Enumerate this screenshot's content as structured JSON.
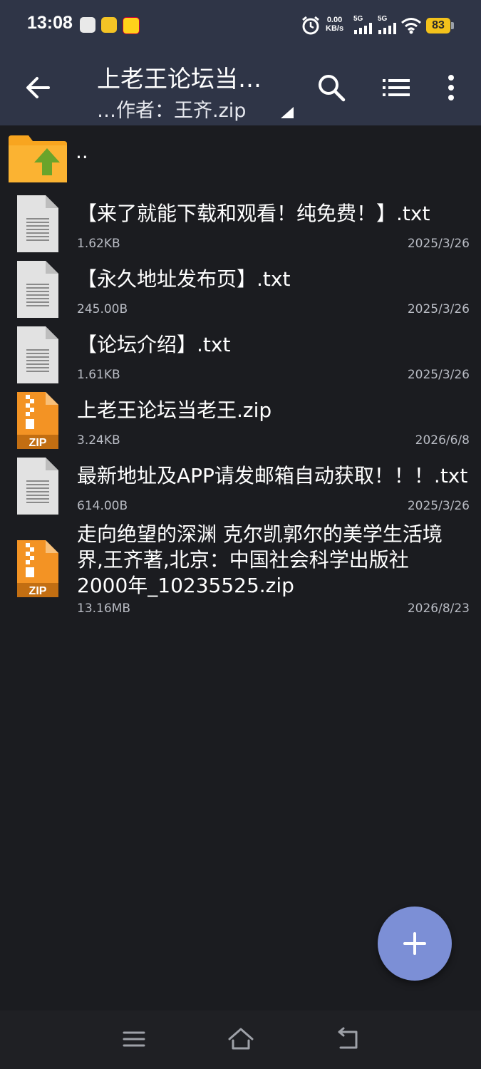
{
  "status_bar": {
    "time": "13:08",
    "net_speed_value": "0.00",
    "net_speed_unit": "KB/s",
    "signal1_label": "5G",
    "signal2_label": "5G",
    "battery": "83"
  },
  "app_bar": {
    "title_line1": "上老王论坛当…",
    "title_line2": "…作者：王齐.zip"
  },
  "parent_dir_label": "..",
  "files": [
    {
      "name": "【来了就能下载和观看！纯免费！】.txt",
      "size": "1.62KB",
      "date": "2025/3/26",
      "type": "txt"
    },
    {
      "name": "【永久地址发布页】.txt",
      "size": "245.00B",
      "date": "2025/3/26",
      "type": "txt"
    },
    {
      "name": "【论坛介绍】.txt",
      "size": "1.61KB",
      "date": "2025/3/26",
      "type": "txt"
    },
    {
      "name": "上老王论坛当老王.zip",
      "size": "3.24KB",
      "date": "2026/6/8",
      "type": "zip"
    },
    {
      "name": "最新地址及APP请发邮箱自动获取！！！.txt",
      "size": "614.00B",
      "date": "2025/3/26",
      "type": "txt"
    },
    {
      "name_lines": [
        "走向绝望的深渊 克尔凯郭尔的美学生活境",
        "界,王齐著,北京：中国社会科学出版社",
        "2000年_10235525.zip"
      ],
      "size": "13.16MB",
      "date": "2026/8/23",
      "type": "zip"
    }
  ],
  "zip_badge": "ZIP",
  "colors": {
    "header_bg": "#2f3547",
    "list_bg": "#1b1c20",
    "fab": "#7c8fd6",
    "zip_orange": "#f39324",
    "folder_orange": "#f8a51f",
    "folder_arrow": "#6aa42b"
  }
}
